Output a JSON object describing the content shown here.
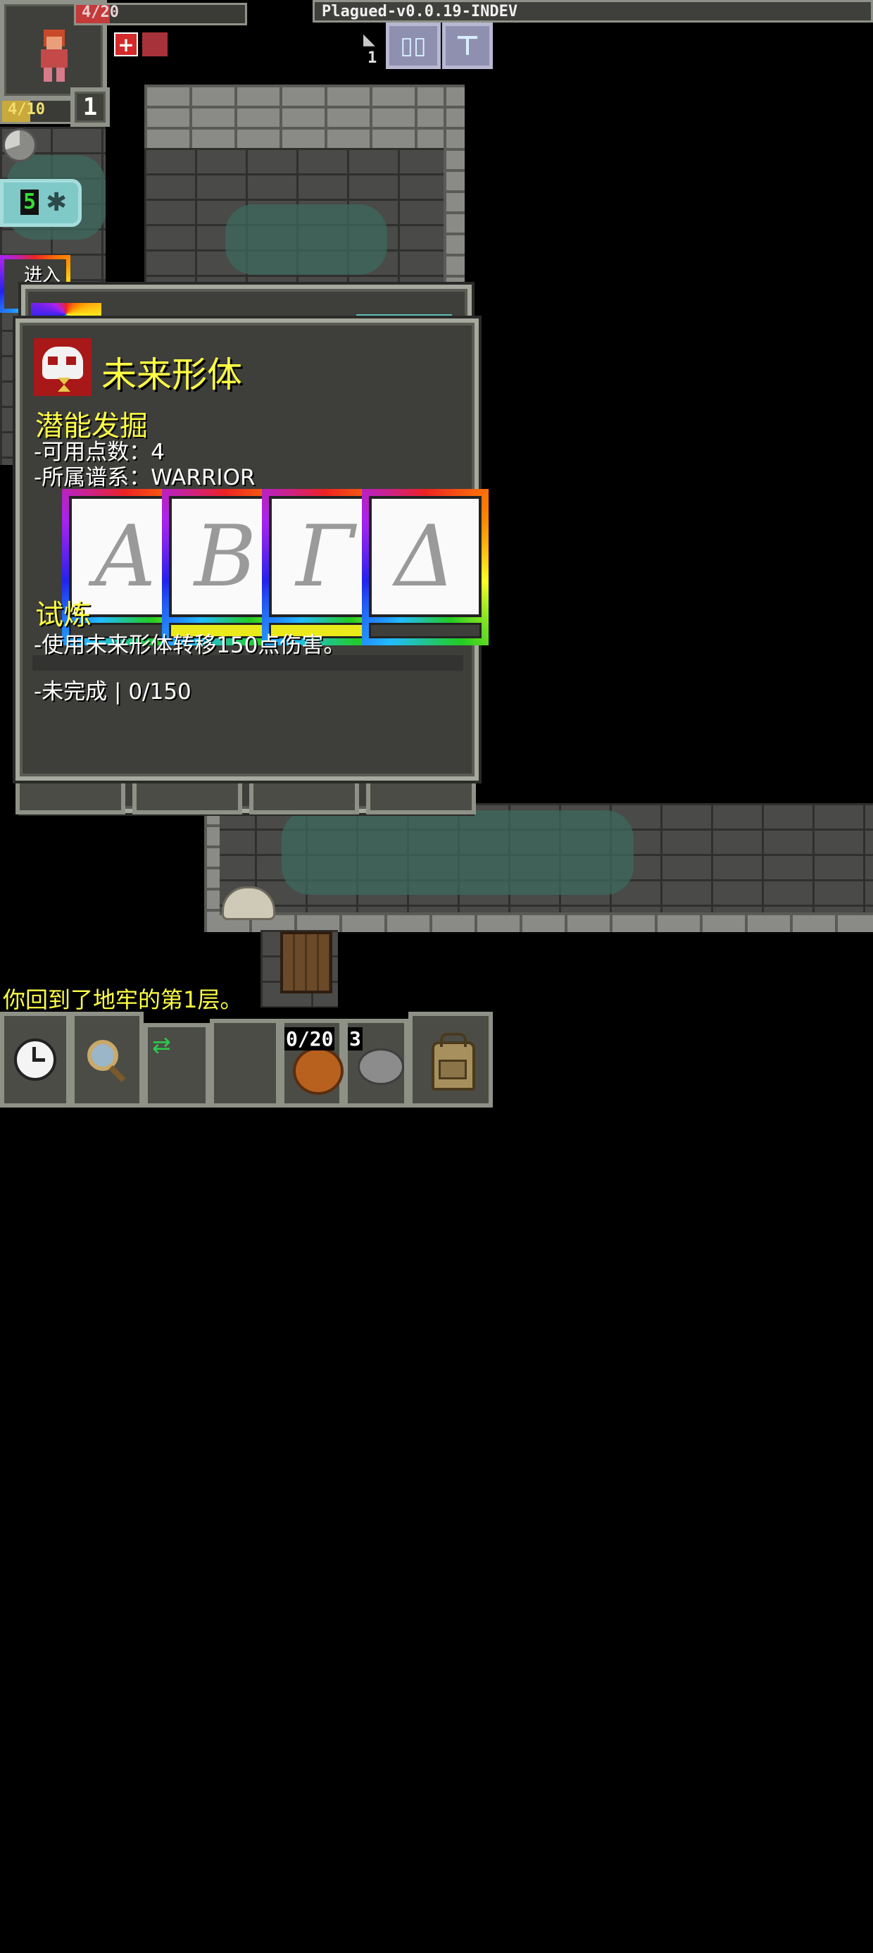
{
  "hud": {
    "hp_text": "4/20",
    "exp_text": "4/10",
    "level": "1",
    "version": "Plagued-v0.0.19-INDEV",
    "depth": "1",
    "busy_count": "5",
    "enter_label": "进入"
  },
  "talent_window": {
    "title": "未来形体",
    "section_title": "潜能发掘",
    "points_line": "-可用点数：4",
    "lineage_line": "-所属谱系：WARRIOR",
    "runes": [
      {
        "glyph": "A",
        "lit": false
      },
      {
        "glyph": "B",
        "lit": true
      },
      {
        "glyph": "Γ",
        "lit": true
      },
      {
        "glyph": "Δ",
        "lit": false
      }
    ],
    "trial_title": "试炼",
    "trial_desc": "-使用未来形体转移150点伤害。",
    "trial_status": "-未完成 | 0/150"
  },
  "log": {
    "message": "你回到了地牢的第1层。"
  },
  "toolbar": {
    "quickslot_count": "0/20",
    "stone_count": "3"
  },
  "icons": [
    "avatar-warrior",
    "buff-health-icon",
    "buff-boot-icon",
    "journal-icon",
    "menu-icon",
    "wait-clock-icon",
    "search-icon",
    "swap-icon",
    "backpack-icon",
    "skull-hourglass-icon"
  ],
  "colors": {
    "accent_yellow": "#ffff44",
    "panel_bg": "#3e3e3a",
    "frame": "#a6a99e",
    "hp_red": "#c43a3a"
  }
}
